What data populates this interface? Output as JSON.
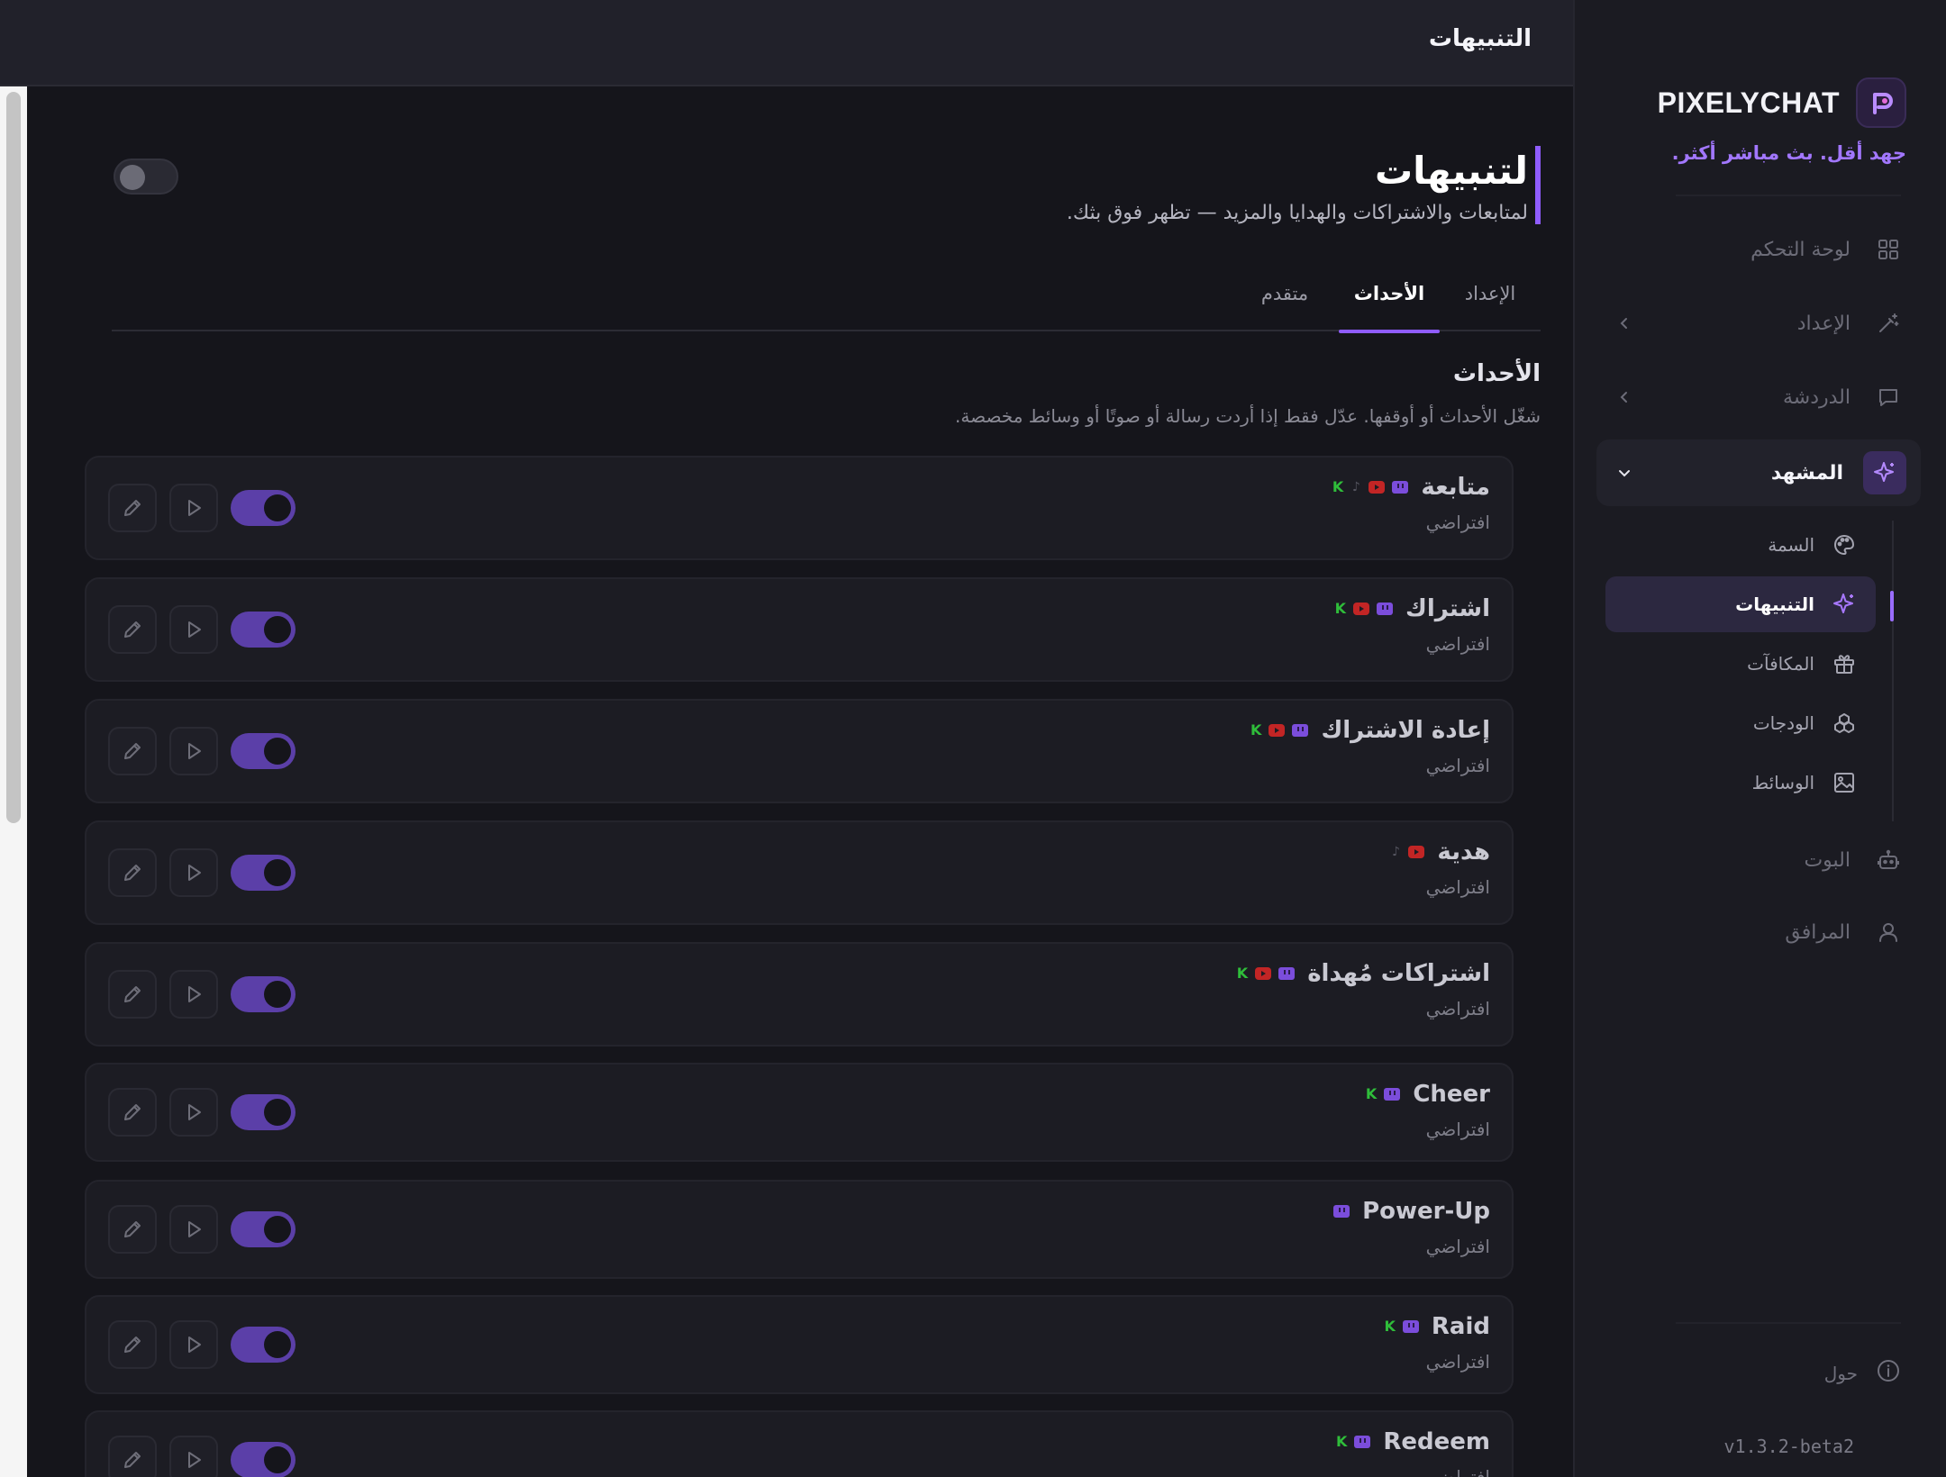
{
  "app": {
    "brand_name": "PIXELYCHAT",
    "tagline": "جهد أقل. بث مباشر أكثر.",
    "version": "v1.3.2-beta2"
  },
  "topbar": {
    "title": "التنبيهات"
  },
  "sidebar": {
    "items": [
      {
        "label": "لوحة التحكم",
        "icon": "dashboard-grid-icon"
      },
      {
        "label": "الإعداد",
        "icon": "wand-icon",
        "expandable": true
      },
      {
        "label": "الدردشة",
        "icon": "chat-bubble-icon",
        "expandable": true
      },
      {
        "label": "المشهد",
        "icon": "sparkle-icon",
        "expanded": true
      },
      {
        "label": "البوت",
        "icon": "robot-icon"
      },
      {
        "label": "المرافق",
        "icon": "user-icon"
      }
    ],
    "scene_children": [
      {
        "label": "السمة",
        "icon": "palette-icon"
      },
      {
        "label": "التنبيهات",
        "icon": "sparkle-icon",
        "active": true
      },
      {
        "label": "المكافآت",
        "icon": "gift-icon"
      },
      {
        "label": "الودجات",
        "icon": "widgets-icon"
      },
      {
        "label": "الوسائط",
        "icon": "image-icon"
      }
    ],
    "about_label": "حول"
  },
  "page": {
    "title": "لتنبيهات",
    "subtitle": "لمتابعات والاشتراكات والهدايا والمزيد — تظهر فوق بثك.",
    "master_enabled": false
  },
  "tabs": [
    {
      "label": "الإعداد"
    },
    {
      "label": "الأحداث",
      "active": true
    },
    {
      "label": "متقدم"
    }
  ],
  "events_section": {
    "title": "الأحداث",
    "description": "شغّل الأحداث أو أوقفها. عدّل فقط إذا أردت رسالة أو صوتًا أو وسائط مخصصة."
  },
  "events": [
    {
      "name": "متابعة",
      "state": "افتراضي",
      "platforms": [
        "twitch",
        "youtube",
        "tiktok",
        "kick"
      ],
      "enabled": true
    },
    {
      "name": "اشتراك",
      "state": "افتراضي",
      "platforms": [
        "twitch",
        "youtube",
        "kick"
      ],
      "enabled": true
    },
    {
      "name": "إعادة الاشتراك",
      "state": "افتراضي",
      "platforms": [
        "twitch",
        "youtube",
        "kick"
      ],
      "enabled": true
    },
    {
      "name": "هدية",
      "state": "افتراضي",
      "platforms": [
        "youtube",
        "tiktok"
      ],
      "enabled": true
    },
    {
      "name": "اشتراكات مُهداة",
      "state": "افتراضي",
      "platforms": [
        "twitch",
        "youtube",
        "kick"
      ],
      "enabled": true
    },
    {
      "name": "Cheer",
      "state": "افتراضي",
      "platforms": [
        "twitch",
        "kick"
      ],
      "enabled": true
    },
    {
      "name": "Power-Up",
      "state": "افتراضي",
      "platforms": [
        "twitch"
      ],
      "enabled": true
    },
    {
      "name": "Raid",
      "state": "افتراضي",
      "platforms": [
        "twitch",
        "kick"
      ],
      "enabled": true
    },
    {
      "name": "Redeem",
      "state": "افتراضي",
      "platforms": [
        "twitch",
        "kick"
      ],
      "enabled": true
    }
  ],
  "colors": {
    "accent": "#8f5cff",
    "toggle_on": "#5b3fa8",
    "twitch": "#7b4ddb",
    "youtube": "#c22525",
    "kick": "#2fbd3a"
  }
}
